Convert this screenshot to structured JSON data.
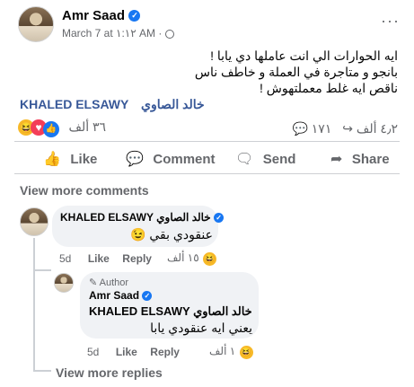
{
  "post": {
    "author_name": "Amr Saad",
    "timestamp": "March 7 at ١:١٢ AM",
    "privacy_icon": "globe-icon",
    "body_lines": [
      "ايه الحوارات الي انت عاملها دي يابا  !",
      "بانجو و متاجرة في العملة و خاطف ناس",
      " ناقص ايه غلط معملتهوش !"
    ],
    "tag_arabic": "خالد الصاوي",
    "tag_english": "KHALED ELSAWY",
    "reactions_count": "٣٦ ألف",
    "comments_count": "٤٫٢ ألف",
    "shares_count": "١٧١"
  },
  "actions": {
    "like": "Like",
    "comment": "Comment",
    "send": "Send",
    "share": "Share"
  },
  "view_more_comments": "View more comments",
  "comment1": {
    "author": "KHALED ELSAWY خالد الصاوي",
    "text": "عنقودي بقي 😉",
    "age": "5d",
    "like": "Like",
    "reply": "Reply",
    "reaction_count": "١٥ ألف"
  },
  "reply1": {
    "badge": "Author",
    "author": "Amr Saad",
    "tag": "KHALED ELSAWY خالد الصاوي",
    "text": "يعني ايه عنقودي يابا",
    "age": "5d",
    "like": "Like",
    "reply": "Reply",
    "reaction_count": "١ ألف"
  },
  "view_more_replies": "View more replies",
  "colors": {
    "accent": "#1877f2",
    "text_secondary": "#65676b",
    "bubble": "#f0f2f5",
    "tag_link": "#385898"
  }
}
